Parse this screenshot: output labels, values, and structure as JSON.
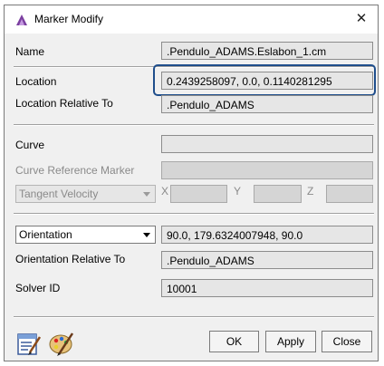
{
  "window": {
    "title": "Marker Modify",
    "close_glyph": "✕"
  },
  "fields": {
    "name": {
      "label": "Name",
      "value": ".Pendulo_ADAMS.Eslabon_1.cm"
    },
    "location": {
      "label": "Location",
      "value": "0.2439258097, 0.0, 0.1140281295"
    },
    "location_relative_to": {
      "label": "Location Relative To",
      "value": ".Pendulo_ADAMS"
    },
    "curve": {
      "label": "Curve",
      "value": ""
    },
    "curve_reference_marker": {
      "label": "Curve Reference Marker",
      "value": ""
    },
    "orientation": {
      "value": "90.0, 179.6324007948, 90.0"
    },
    "orientation_relative_to": {
      "label": "Orientation Relative To",
      "value": ".Pendulo_ADAMS"
    },
    "solver_id": {
      "label": "Solver ID",
      "value": "10001"
    }
  },
  "tangent_velocity": {
    "selected": "Tangent Velocity",
    "x_label": "X",
    "y_label": "Y",
    "z_label": "Z"
  },
  "orientation_combo": {
    "selected": "Orientation"
  },
  "buttons": {
    "ok": "OK",
    "apply": "Apply",
    "close": "Close"
  },
  "icons": {
    "title": "adams-app-icon",
    "edit": "edit-table-icon",
    "appearance": "palette-brush-icon"
  },
  "colors": {
    "highlight": "#1f4e8c",
    "field_bg": "#e6e6e6",
    "dialog_bg": "#f0f0f0"
  }
}
